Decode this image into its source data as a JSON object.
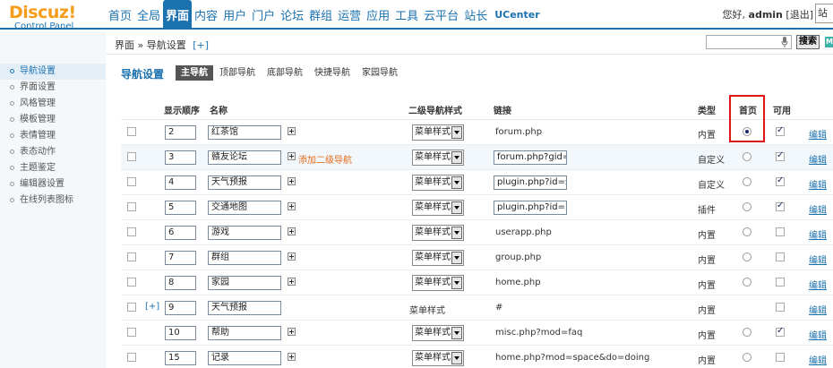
{
  "logo": {
    "main": "Discuz!",
    "sub": "Control Panel"
  },
  "topnav": [
    {
      "label": "首页"
    },
    {
      "label": "全局"
    },
    {
      "label": "界面",
      "active": true
    },
    {
      "label": "内容"
    },
    {
      "label": "用户"
    },
    {
      "label": "门户"
    },
    {
      "label": "论坛"
    },
    {
      "label": "群组"
    },
    {
      "label": "运营"
    },
    {
      "label": "应用"
    },
    {
      "label": "工具"
    },
    {
      "label": "云平台"
    },
    {
      "label": "站长"
    },
    {
      "label": "UCenter"
    }
  ],
  "userbar": {
    "greeting": "您好,",
    "user": "admin",
    "logout": "[退出]",
    "site": "站点"
  },
  "breadcrumb": {
    "path": "界面 » 导航设置",
    "plus": "[+]"
  },
  "search": {
    "button": "搜索",
    "badge": "M"
  },
  "sidebar": [
    {
      "label": "导航设置",
      "active": true
    },
    {
      "label": "界面设置"
    },
    {
      "label": "风格管理"
    },
    {
      "label": "模板管理"
    },
    {
      "label": "表情管理"
    },
    {
      "label": "表态动作"
    },
    {
      "label": "主题鉴定"
    },
    {
      "label": "编辑器设置"
    },
    {
      "label": "在线列表图标"
    }
  ],
  "page": {
    "title": "导航设置"
  },
  "subtabs": [
    {
      "label": "主导航",
      "active": true
    },
    {
      "label": "顶部导航"
    },
    {
      "label": "底部导航"
    },
    {
      "label": "快捷导航"
    },
    {
      "label": "家园导航"
    }
  ],
  "columns": {
    "order": "显示顺序",
    "name": "名称",
    "sub_style": "二级导航样式",
    "link": "链接",
    "type": "类型",
    "home": "首页",
    "available": "可用"
  },
  "rows": [
    {
      "order": "2",
      "name": "红茶馆",
      "style": "菜单样式",
      "link": "forum.php",
      "type": "内置",
      "home": true,
      "available": true,
      "edit": "编辑"
    },
    {
      "order": "3",
      "name": "赣友论坛",
      "add_sub": "添加二级导航",
      "style": "菜单样式",
      "link": "forum.php?gid=",
      "type": "自定义",
      "home": false,
      "available": true,
      "edit": "编辑"
    },
    {
      "order": "4",
      "name": "天气预报",
      "style": "菜单样式",
      "link": "plugin.php?id=s",
      "type": "自定义",
      "home": false,
      "available": true,
      "edit": "编辑"
    },
    {
      "order": "5",
      "name": "交通地图",
      "style": "菜单样式",
      "link": "plugin.php?id=it",
      "type": "插件",
      "home": false,
      "available": true,
      "edit": "编辑"
    },
    {
      "order": "6",
      "name": "游戏",
      "style": "菜单样式",
      "link": "userapp.php",
      "type": "内置",
      "home": false,
      "available": false,
      "edit": "编辑"
    },
    {
      "order": "7",
      "name": "群组",
      "style": "菜单样式",
      "link": "group.php",
      "type": "内置",
      "home": false,
      "available": false,
      "edit": "编辑"
    },
    {
      "order": "8",
      "name": "家园",
      "style": "菜单样式",
      "link": "home.php",
      "type": "内置",
      "home": false,
      "available": false,
      "edit": "编辑"
    },
    {
      "order": "9",
      "name": "天气预报",
      "expand": "[+]",
      "style": "菜单样式",
      "link": "#",
      "type": "内置",
      "home": false,
      "available": false,
      "edit": "编辑"
    },
    {
      "order": "10",
      "name": "帮助",
      "style": "菜单样式",
      "link": "misc.php?mod=faq",
      "type": "内置",
      "home": false,
      "available": true,
      "edit": "编辑"
    },
    {
      "order": "15",
      "name": "记录",
      "style": "菜单样式",
      "link": "home.php?mod=space&do=doing",
      "type": "内置",
      "home": false,
      "available": false,
      "edit": "编辑"
    }
  ]
}
